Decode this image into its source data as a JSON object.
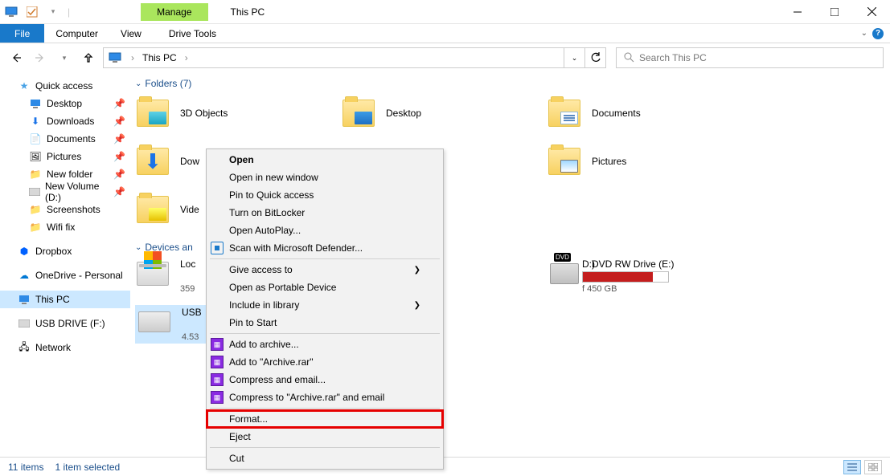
{
  "titlebar": {
    "manage_label": "Manage",
    "title": "This PC"
  },
  "ribbon": {
    "file": "File",
    "computer": "Computer",
    "view": "View",
    "drive_tools": "Drive Tools"
  },
  "address": {
    "location": "This PC"
  },
  "search": {
    "placeholder": "Search This PC"
  },
  "sidebar": {
    "quick_access": "Quick access",
    "qa": {
      "desktop": "Desktop",
      "downloads": "Downloads",
      "documents": "Documents",
      "pictures": "Pictures",
      "new_folder": "New folder",
      "new_volume": "New Volume (D:)",
      "screenshots": "Screenshots",
      "wifi_fix": "Wifi fix"
    },
    "dropbox": "Dropbox",
    "onedrive": "OneDrive - Personal",
    "this_pc": "This PC",
    "usb_drive": "USB DRIVE (F:)",
    "network": "Network"
  },
  "sections": {
    "folders": "Folders (7)",
    "folder_items": {
      "objects3d": "3D Objects",
      "desktop": "Desktop",
      "documents": "Documents",
      "downloads": "Dow",
      "videos": "Vide",
      "pictures": "Pictures"
    },
    "devices": "Devices an",
    "drives": {
      "local_c": {
        "name": "Loc",
        "sub": "359"
      },
      "new_vol_d": {
        "name": "D:)",
        "sub": "f 450 GB"
      },
      "dvd_e": {
        "name": "DVD RW Drive (E:)"
      },
      "usb_f": {
        "name": "USB",
        "sub": "4.53"
      }
    }
  },
  "context_menu": {
    "open": "Open",
    "open_new_window": "Open in new window",
    "pin_quick_access": "Pin to Quick access",
    "bitlocker": "Turn on BitLocker",
    "autoplay": "Open AutoPlay...",
    "defender": "Scan with Microsoft Defender...",
    "give_access": "Give access to",
    "portable": "Open as Portable Device",
    "include_library": "Include in library",
    "pin_start": "Pin to Start",
    "add_archive": "Add to archive...",
    "add_archive_rar": "Add to \"Archive.rar\"",
    "compress_email": "Compress and email...",
    "compress_archive_email": "Compress to \"Archive.rar\" and email",
    "format": "Format...",
    "eject": "Eject",
    "cut": "Cut"
  },
  "statusbar": {
    "count": "11 items",
    "selected": "1 item selected"
  }
}
